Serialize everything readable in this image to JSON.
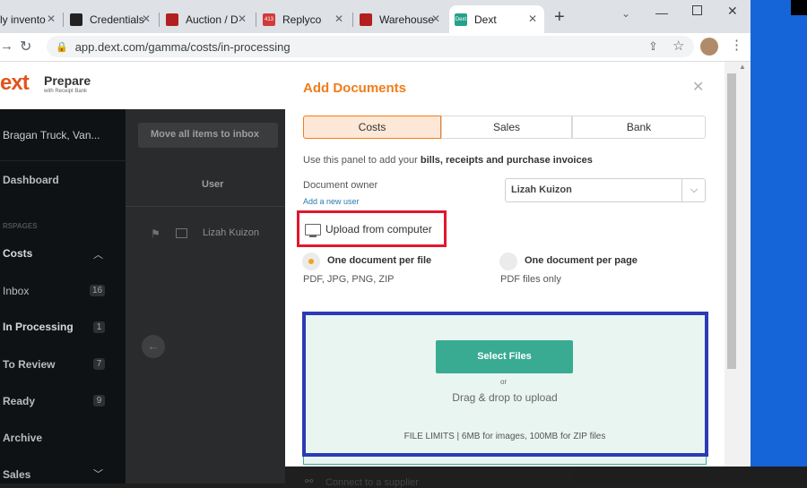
{
  "browser": {
    "tabs": [
      {
        "label": "ly invento",
        "fav_color": "#f0f0f0"
      },
      {
        "label": "Credentials",
        "fav_color": "#222222"
      },
      {
        "label": "Auction / D",
        "fav_color": "#b21f1f"
      },
      {
        "label": "Replyco",
        "fav_color": "#d13a3a"
      },
      {
        "label": "Warehouse",
        "fav_color": "#b21f1f"
      },
      {
        "label": "Dext",
        "fav_color": "#25a189"
      }
    ],
    "tab_fav_text": {
      "replyco": "413",
      "dext": "Dext"
    },
    "url": "app.dext.com/gamma/costs/in-processing"
  },
  "app": {
    "logo": "ext",
    "product": "Prepare",
    "product_sub": "with Receipt Bank",
    "account": "Bragan Truck, Van...",
    "nav": {
      "dashboard": "Dashboard",
      "section": "RSPAGES",
      "costs": "Costs",
      "inbox": "Inbox",
      "inbox_count": "16",
      "in_processing": "In Processing",
      "in_processing_count": "1",
      "to_review": "To Review",
      "to_review_count": "7",
      "ready": "Ready",
      "ready_count": "9",
      "archive": "Archive",
      "sales": "Sales"
    },
    "main": {
      "move_all": "Move all items to inbox",
      "col_user": "User",
      "row_user": "Lizah Kuizon"
    }
  },
  "modal": {
    "title": "Add Documents",
    "tabs": [
      "Costs",
      "Sales",
      "Bank"
    ],
    "intro_prefix": "Use this panel to add your ",
    "intro_bold": "bills, receipts and purchase invoices",
    "owner_label": "Document owner",
    "add_user": "Add a new user",
    "owner_value": "Lizah Kuizon",
    "upload_from": "Upload from computer",
    "option1_title": "One document per file",
    "option1_sub": "PDF, JPG, PNG, ZIP",
    "option2_title": "One document per page",
    "option2_sub": "PDF files only",
    "select_files": "Select Files",
    "or": "or",
    "drag_drop": "Drag & drop to upload",
    "file_limits": "FILE LIMITS | 6MB for images, 100MB for ZIP files",
    "connect": "Connect to a supplier"
  },
  "colors": {
    "accent": "#f07d1a",
    "teal": "#3aab93",
    "dropzone": "#e9f5f1",
    "red_box": "#e0182d",
    "blue_box": "#2b3bb5"
  }
}
